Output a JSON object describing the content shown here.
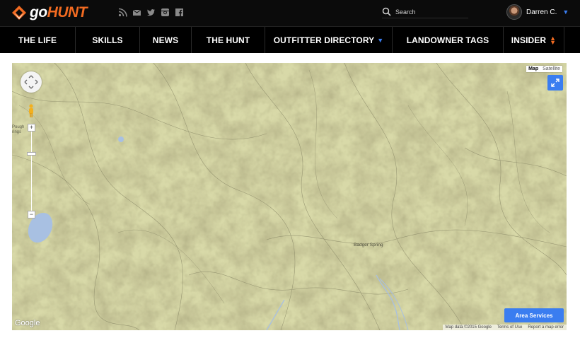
{
  "brand": {
    "go": "go",
    "hunt": "HUNT",
    "accent": "#f26b21"
  },
  "social": [
    "rss-icon",
    "email-icon",
    "twitter-icon",
    "instagram-icon",
    "facebook-icon"
  ],
  "search": {
    "placeholder": "Search"
  },
  "user": {
    "name": "Darren C."
  },
  "nav": {
    "items": [
      {
        "label": "THE LIFE"
      },
      {
        "label": "SKILLS"
      },
      {
        "label": "NEWS"
      },
      {
        "label": "THE HUNT"
      },
      {
        "label": "OUTFITTER DIRECTORY",
        "dropdown": true
      },
      {
        "label": "LANDOWNER TAGS"
      },
      {
        "label": "INSIDER"
      }
    ]
  },
  "map": {
    "type_map": "Map",
    "type_satellite": "Satellite",
    "selected_type": "Map",
    "label_badger": "Badger Spring",
    "label_pough": "Pough",
    "label_pough2": "rings",
    "area_button": "Area Services",
    "google": "Google",
    "attribution": {
      "data": "Map data ©2015 Google",
      "terms": "Terms of Use",
      "report": "Report a map error"
    },
    "accent": "#3a7df0"
  }
}
